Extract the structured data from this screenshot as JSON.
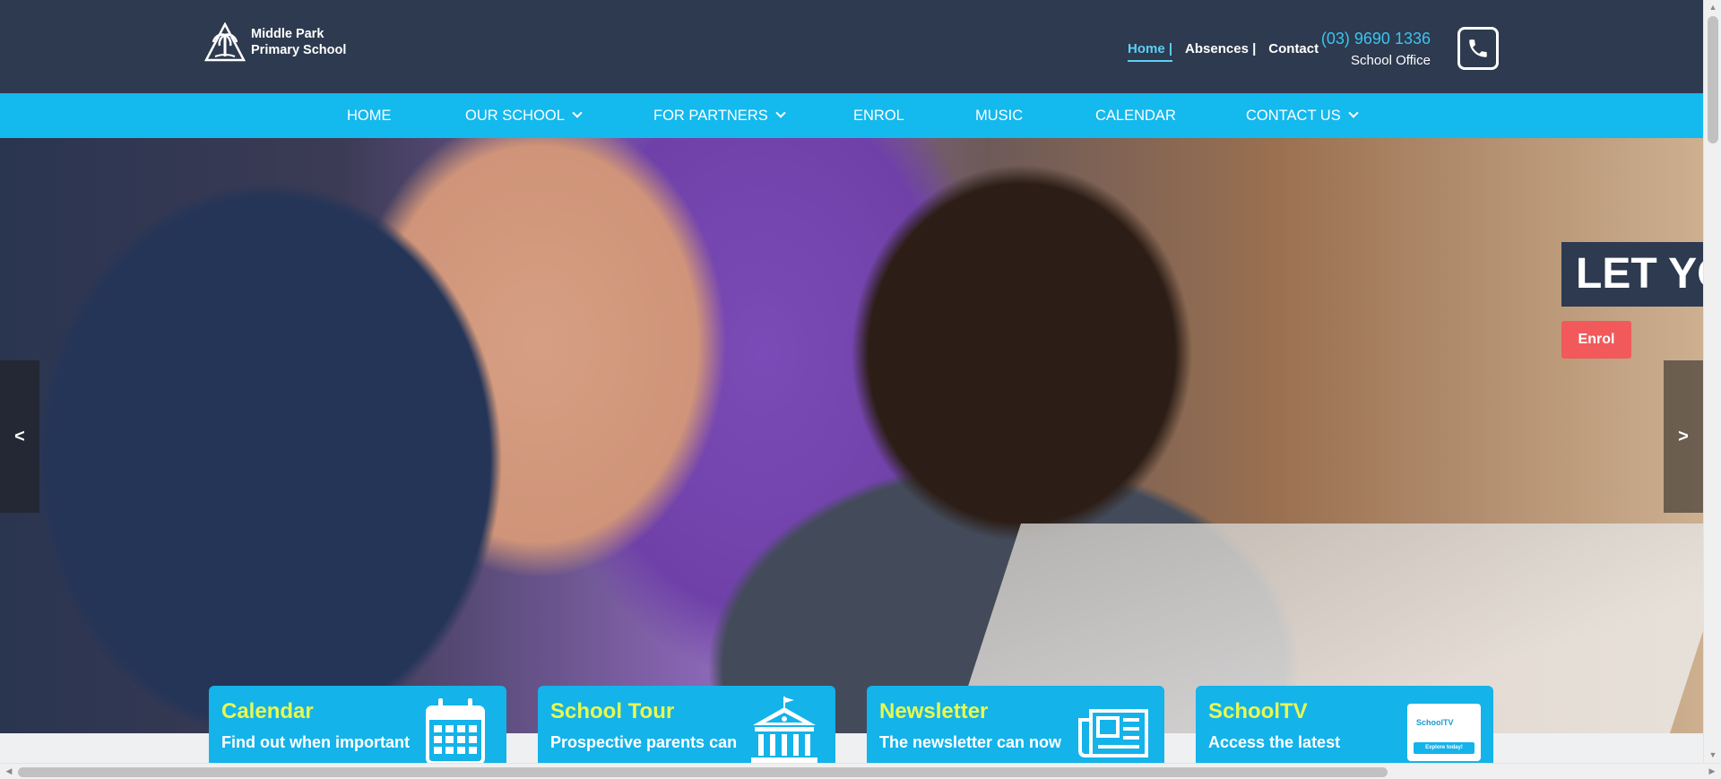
{
  "logo": {
    "line1": "Middle Park",
    "line2": "Primary School",
    "icon": "palm-tree-icon"
  },
  "top_links": [
    {
      "label": "Home |",
      "active": true
    },
    {
      "label": "Absences |",
      "active": false
    },
    {
      "label": "Contact",
      "active": false
    }
  ],
  "phone": {
    "number": "(03) 9690 1336",
    "label": "School Office",
    "icon": "phone-icon"
  },
  "nav": [
    {
      "label": "HOME",
      "dropdown": false
    },
    {
      "label": "OUR SCHOOL",
      "dropdown": true
    },
    {
      "label": "FOR PARTNERS",
      "dropdown": true
    },
    {
      "label": "ENROL",
      "dropdown": false
    },
    {
      "label": "MUSIC",
      "dropdown": false
    },
    {
      "label": "CALENDAR",
      "dropdown": false
    },
    {
      "label": "CONTACT US",
      "dropdown": true
    }
  ],
  "hero": {
    "slide_title": "LET YO",
    "button": "Enrol",
    "prev": "<",
    "next": ">"
  },
  "cards": [
    {
      "title": "Calendar",
      "text": "Find out when important",
      "icon": "calendar-icon"
    },
    {
      "title": "School Tour",
      "text": "Prospective parents can",
      "icon": "school-building-icon"
    },
    {
      "title": "Newsletter",
      "text": "The newsletter can now",
      "icon": "newspaper-icon"
    },
    {
      "title": "SchoolTV",
      "text": "Access the latest",
      "icon": "schooltv-thumbnail",
      "thumb_logo": "SchoolTV",
      "thumb_button": "Explore today!"
    }
  ],
  "colors": {
    "header_bg": "#2d3a4f",
    "nav_bg": "#14b9ee",
    "accent": "#5bd0f5",
    "card_bg": "#14b3ea",
    "card_title": "#e9f84f",
    "enrol_button": "#f2595b"
  }
}
